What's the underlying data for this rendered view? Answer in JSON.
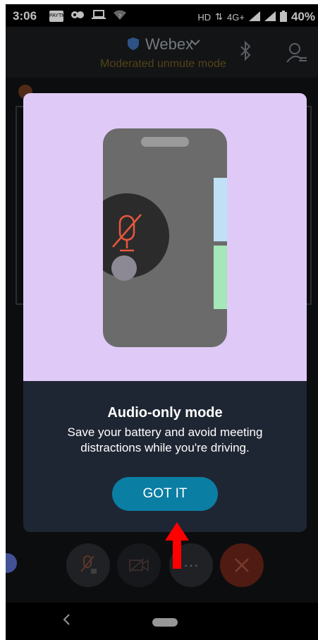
{
  "statusbar": {
    "time": "3:06",
    "paytm": "PAYTM",
    "network": "HD",
    "signal": "4G+",
    "battery": "40%"
  },
  "header": {
    "title": "Webex",
    "subtitle": "Moderated unmute mode"
  },
  "modal": {
    "title": "Audio-only mode",
    "body": "Save your battery and avoid meeting distractions while you're driving.",
    "button": "GOT IT"
  },
  "colors": {
    "accent": "#0b7ea3",
    "illustration_bg": "#dfcaf7",
    "modal_bg": "#1f2633",
    "mic_red": "#e8583c",
    "arrow_red": "#ff0000"
  }
}
